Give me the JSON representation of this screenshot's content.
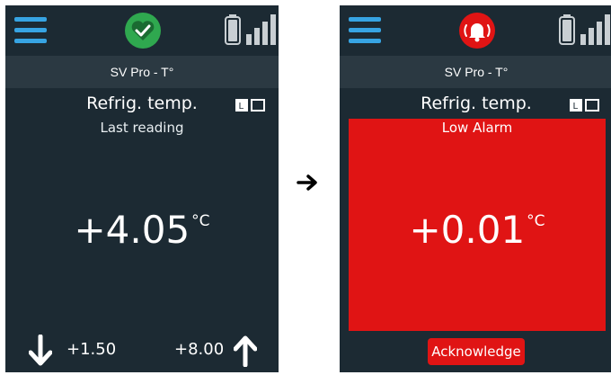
{
  "colors": {
    "screen_bg": "#1c2a33",
    "header_bg": "#2b3942",
    "accent_blue": "#37a4e3",
    "ok_green": "#2fa84f",
    "alarm_red": "#e01414",
    "icon_gray": "#c9cfd3"
  },
  "left_screen": {
    "status_icon": "heart-check-icon",
    "device_name": "SV Pro - T°",
    "panel_title": "Refrig. temp.",
    "subtitle": "Last reading",
    "reading_value": "+4.05",
    "reading_unit": "°C",
    "low_limit": "+1.50",
    "high_limit": "+8.00"
  },
  "right_screen": {
    "status_icon": "alarm-bell-icon",
    "device_name": "SV Pro - T°",
    "panel_title": "Refrig. temp.",
    "subtitle": "Low Alarm",
    "reading_value": "+0.01",
    "reading_unit": "°C",
    "acknowledge_label": "Acknowledge"
  }
}
